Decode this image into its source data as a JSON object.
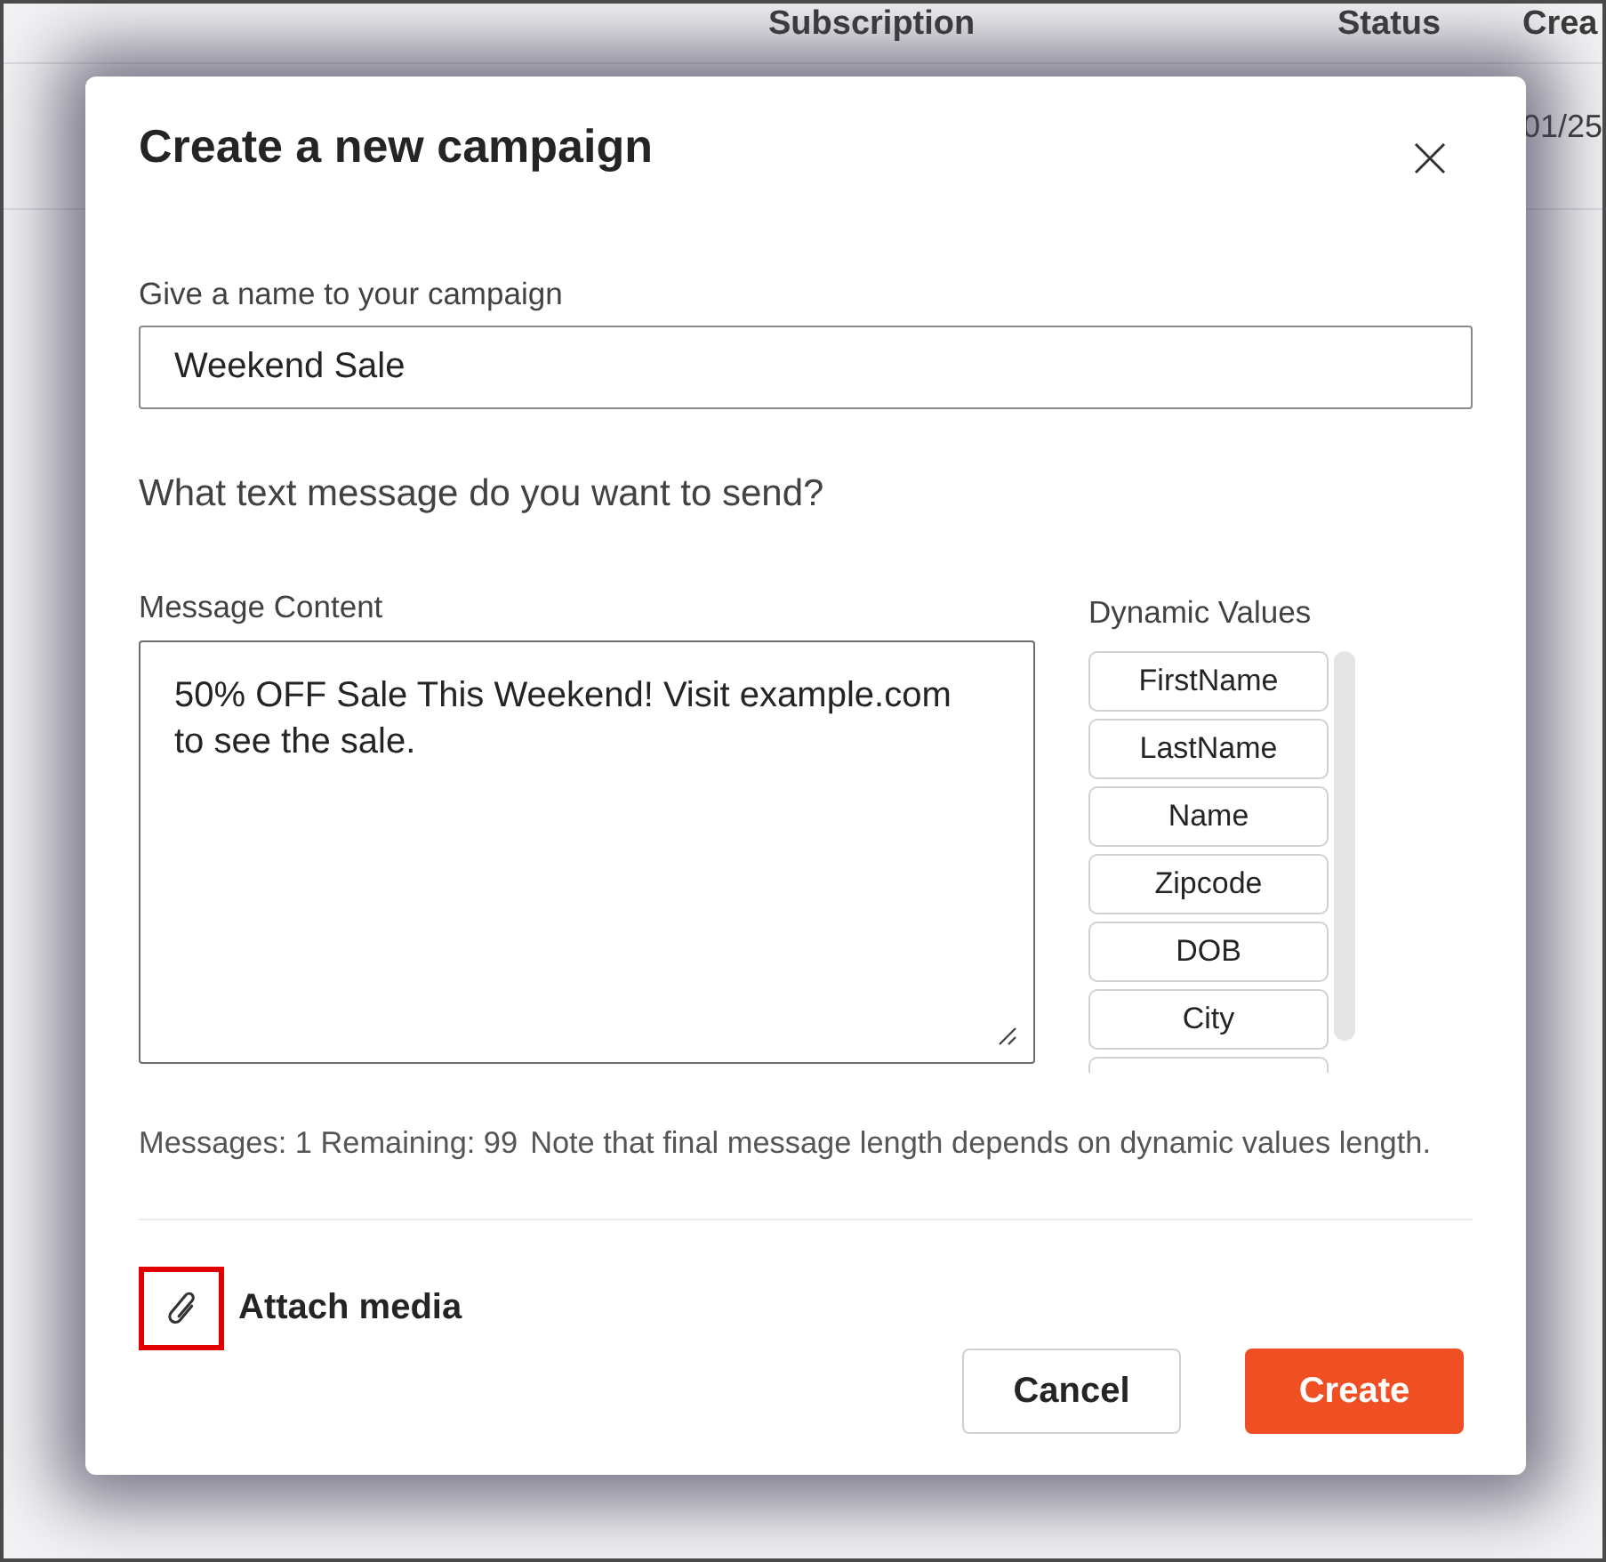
{
  "background_table": {
    "columns": [
      "Subscription",
      "Status",
      "Crea"
    ],
    "row_text": "01/25"
  },
  "dialog": {
    "title": "Create a new campaign",
    "name_field": {
      "label": "Give a name to your campaign",
      "value": "Weekend Sale"
    },
    "prompt": "What text message do you want to send?",
    "message_field": {
      "label": "Message Content",
      "value": "50% OFF Sale This Weekend! Visit example.com to see the sale."
    },
    "dynamic_values": {
      "title": "Dynamic Values",
      "items": [
        {
          "kind": "chip",
          "label": "FirstName"
        },
        {
          "kind": "chip",
          "label": "LastName"
        },
        {
          "kind": "chip",
          "label": "Name"
        },
        {
          "kind": "chip",
          "label": "Zipcode"
        },
        {
          "kind": "chip",
          "label": "DOB"
        },
        {
          "kind": "chip",
          "label": "City"
        },
        {
          "kind": "clipped"
        }
      ]
    },
    "counter": "Messages: 1 Remaining: 99",
    "note": "Note that final message length depends on dynamic values length.",
    "attach": {
      "label": "Attach media",
      "highlighted": true
    },
    "buttons": [
      {
        "kind": "secondary",
        "label": "Cancel"
      },
      {
        "kind": "primary",
        "label": "Create"
      }
    ]
  }
}
